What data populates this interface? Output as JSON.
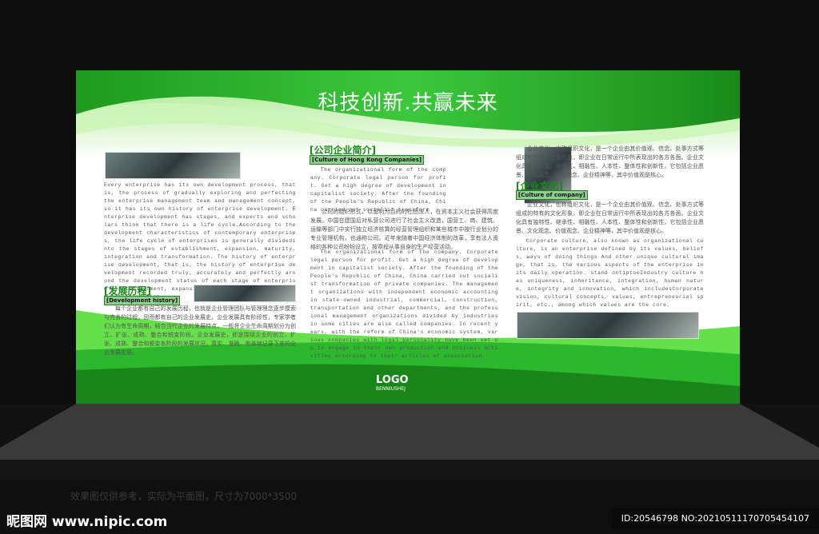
{
  "board": {
    "title": "科技创新.共赢未来",
    "logo": {
      "text": "LOGO",
      "subtext": "BENNIUSHEJ"
    },
    "col1": {
      "en": "Every enterprise has its own development process, that is, the process of gradually exploring and perfecting the enterprise management team and management concept, so it has its own history of enterprise development. Enterprise development has stages, and experts and scholars think that there is a life cycle.According to the development characteristics of contemporary enterprises, the life cycle of enterprises is generally dividedinto the stages of establishment, expansion, maturity, integration and transformation. The history of enterprise development, that is, the history of enterprise development recorded truly, accurately and perfectly around the development status of each stage of enterprise's establishment, expansion, maturity, integration and transformation.",
      "heading": "[发展历程]",
      "subheading": "[Development history]",
      "cn": "每个企业都有自己的发展历程，也就是企业管理团队与管理理念逐步摸索与完善的过程，因而都有自己的企业发展史。企业发展具有阶段性，专家学者们认为有生命周期，结合当代企业的发展特点，一般将企业生命周期划分为创立、扩张、成熟、整合和蜕变阶段。企业发展史，即是围绕企业的创立、扩张、成熟、整合和蜕变各阶段的发展状况，真实、准确、完善地记录下来的企业发展史册。"
    },
    "col2": {
      "heading": "[公司企业简介]",
      "subheading": "[Culture of Hong Kong Companies]",
      "en1": "The organizational form of the company. Corporate legal person for profit. Get a high degree of development in capitalist society. After the founding of the People's Republic of China, China carried out socialist transform",
      "cn": "公司的组织形式，以营利为目的的社团法人，在资本主义社会获得高度发展。中国在建国后对私营公司进行了社会主义改造，国营工、商、建筑、运输等部门中实行独立经济核算的经营管理组织和某些城市中按行业划分的专业管理机构，也通称公司。近年来随着中国经济体制的改革，享有法人资格的各种公司纷纷设立，按章程从事自身的生产经营活动。",
      "en2": "The organizational form of the company. Corporate legal person for profit. Get a high degree of development in capitalist society. After the founding of the People's Republic of China, China carried out socialist transformation of private companies. The management organizations with independent economic accounting in state-owned industrial, commercial, construction, transportation and other departments, and the professional management organizations divided by industries in some cities are also called companies. In recent years, with the reform of China's economic system, various companies with legal personality have been set up to engage in their own production and business activities according to their articles of association."
    },
    "col3": {
      "cn1": "企业文化，也称组织文化，是一个企业由其价值观、信念、处事方式等组成的特有的文化形象，即企业在日常运行中所表现出的各方各面。企业文化具有独特性、继承性、相融性、人本性、整体性和创新性，它包括企业愿景、文化观念、价值观念、企业精神等，其中价值观是核心。",
      "heading": "[企业文化]",
      "subheading": "[Culture of company]",
      "cn2": "企业文化，也称组织文化，是一个企业由其价值观、信念、处事方式等组成的特有的文化形象，即企业在日常运行中所表现出的各方各面。企业文化具有独特性、继承性、相融性、人本性、整体性和创新性，它包括企业愿景、文化观念、价值观念、企业精神等，其中价值观是核心。",
      "en": "Corporate culture, also known as organizational culture, is an enterprise defined by its values, beliefs, ways of doing things And other unique cultural image, that is, the various aspects of the enterprise in its daily operation. stand ontiptoeIndustry culture has uniqueness, inheritance, integration, human nature, integrity and innovation, which includesCorporate vision, cultural concepts, values, entrepreneurial spirit, etc., among which values are the core."
    }
  },
  "footer": {
    "note": "效果图仅供参考，实际为平面图，尺寸为7000*3500",
    "watermark": "昵图网 www.nipic.com",
    "id": "ID:20546798 NO:20210511170705454107"
  },
  "colors": {
    "green_dark": "#1a8a1a",
    "green_light": "#6ee84a"
  }
}
